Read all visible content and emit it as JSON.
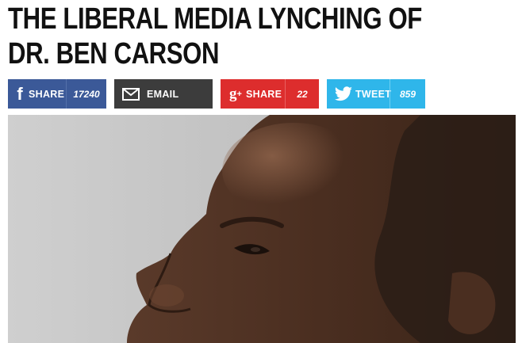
{
  "article": {
    "headline": "THE LIBERAL MEDIA LYNCHING OF DR. BEN CARSON"
  },
  "share_bar": {
    "facebook": {
      "label": "SHARE",
      "count": "17240",
      "icon": "facebook-icon",
      "color": "#3b5998"
    },
    "email": {
      "label": "EMAIL",
      "icon": "envelope-icon",
      "color": "#3c3c3c"
    },
    "google_plus": {
      "label": "SHARE",
      "count": "22",
      "icon": "google-plus-icon",
      "color": "#dd2d2d"
    },
    "twitter": {
      "label": "TWEET",
      "count": "859",
      "icon": "twitter-bird-icon",
      "color": "#2fb6ea"
    }
  },
  "hero_image": {
    "subject": "profile-photo",
    "background_color": "#c4c4c4"
  }
}
